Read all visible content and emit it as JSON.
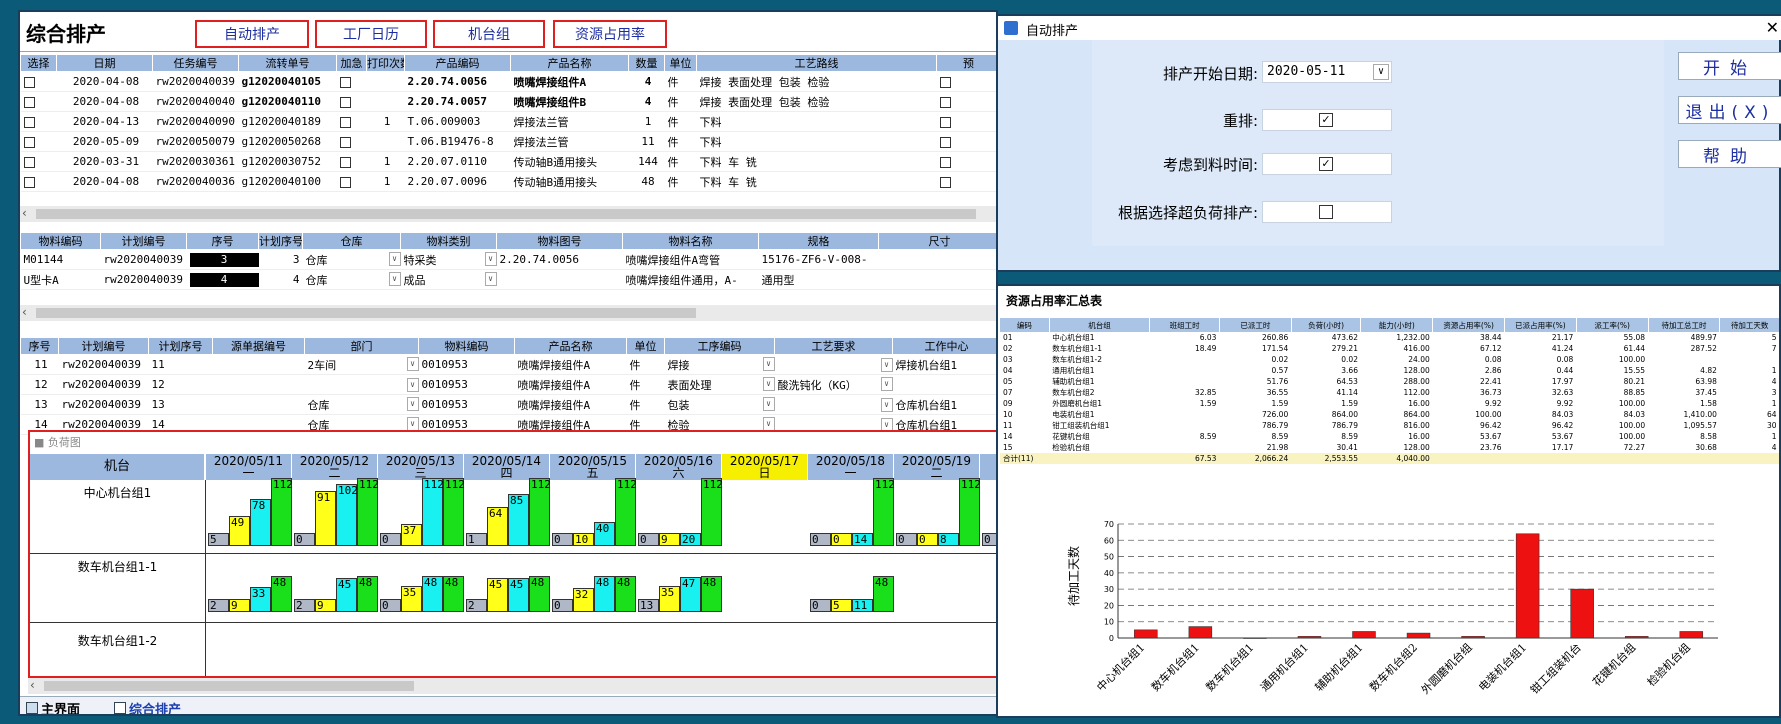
{
  "main": {
    "title": "综合排产",
    "top_buttons": [
      "自动排产",
      "工厂日历",
      "机台组",
      "资源占用率"
    ]
  },
  "order_table": {
    "headers": [
      "选择",
      "日期",
      "任务编号",
      "流转单号",
      "加急",
      "打印次数",
      "产品编码",
      "产品名称",
      "数量",
      "单位",
      "工艺路线",
      "预"
    ],
    "rows": [
      {
        "date": "2020-04-08",
        "task": "rw2020040039",
        "flow": "g12020040105",
        "print": "",
        "code": "2.20.74.0056",
        "name": "喷嘴焊接组件A",
        "qty": "4",
        "unit": "件",
        "route": "焊接 表面处理 包装 检验",
        "bold": true
      },
      {
        "date": "2020-04-08",
        "task": "rw2020040040",
        "flow": "g12020040110",
        "print": "",
        "code": "2.20.74.0057",
        "name": "喷嘴焊接组件B",
        "qty": "4",
        "unit": "件",
        "route": "焊接 表面处理 包装 检验",
        "bold": true
      },
      {
        "date": "2020-04-13",
        "task": "rw2020040090",
        "flow": "g12020040189",
        "print": "1",
        "code": "T.06.009003",
        "name": "焊接法兰管",
        "qty": "1",
        "unit": "件",
        "route": "下料",
        "bold": false
      },
      {
        "date": "2020-05-09",
        "task": "rw2020050079",
        "flow": "g12020050268",
        "print": "",
        "code": "T.06.B19476-8",
        "name": "焊接法兰管",
        "qty": "11",
        "unit": "件",
        "route": "下料",
        "bold": false
      },
      {
        "date": "2020-03-31",
        "task": "rw2020030361",
        "flow": "g12020030752",
        "print": "1",
        "code": "2.20.07.0110",
        "name": "传动轴B通用接头",
        "qty": "144",
        "unit": "件",
        "route": "下料 车 铣",
        "bold": false
      },
      {
        "date": "2020-04-08",
        "task": "rw2020040036",
        "flow": "g12020040100",
        "print": "1",
        "code": "2.20.07.0096",
        "name": "传动轴B通用接头",
        "qty": "48",
        "unit": "件",
        "route": "下料 车 铣",
        "bold": false
      }
    ]
  },
  "material_table": {
    "headers": [
      "物料编码",
      "计划编号",
      "序号",
      "计划序号",
      "仓库",
      "物料类别",
      "物料图号",
      "物料名称",
      "规格",
      "尺寸"
    ],
    "rows": [
      {
        "code": "M01144",
        "plan": "rw2020040039",
        "seq": "3",
        "planseq": "3",
        "wh": "仓库",
        "cat": "特采类",
        "drawing": "2.20.74.0056",
        "name": "喷嘴焊接组件A弯管",
        "spec": "15176-ZF6-V-008-",
        "size": ""
      },
      {
        "code": "U型卡A",
        "plan": "rw2020040039",
        "seq": "4",
        "planseq": "4",
        "wh": "仓库",
        "cat": "成品",
        "drawing": "",
        "name": "喷嘴焊接组件通用，A-",
        "spec": "通用型",
        "size": ""
      }
    ]
  },
  "process_table": {
    "headers": [
      "序号",
      "计划编号",
      "计划序号",
      "源单据编号",
      "部门",
      "物料编码",
      "产品名称",
      "单位",
      "工序编码",
      "工艺要求",
      "工作中心"
    ],
    "rows": [
      {
        "seq": "11",
        "plan": "rw2020040039",
        "planseq": "11",
        "src": "",
        "dept": "2车间",
        "mat": "0010953",
        "name": "喷嘴焊接组件A",
        "unit": "件",
        "proc": "焊接",
        "req": "",
        "center": "焊接机台组1"
      },
      {
        "seq": "12",
        "plan": "rw2020040039",
        "planseq": "12",
        "src": "",
        "dept": "",
        "mat": "0010953",
        "name": "喷嘴焊接组件A",
        "unit": "件",
        "proc": "表面处理",
        "req": "酸洗钝化（KG）",
        "center": ""
      },
      {
        "seq": "13",
        "plan": "rw2020040039",
        "planseq": "13",
        "src": "",
        "dept": "仓库",
        "mat": "0010953",
        "name": "喷嘴焊接组件A",
        "unit": "件",
        "proc": "包装",
        "req": "",
        "center": "仓库机台组1"
      },
      {
        "seq": "14",
        "plan": "rw2020040039",
        "planseq": "14",
        "src": "",
        "dept": "仓库",
        "mat": "0010953",
        "name": "喷嘴焊接组件A",
        "unit": "件",
        "proc": "检验",
        "req": "",
        "center": "仓库机台组1"
      }
    ]
  },
  "load_chart": {
    "title": "负荷图",
    "machine_header": "机台",
    "dates": [
      {
        "date": "2020/05/11",
        "dow": "一",
        "sun": false
      },
      {
        "date": "2020/05/12",
        "dow": "二",
        "sun": false
      },
      {
        "date": "2020/05/13",
        "dow": "三",
        "sun": false
      },
      {
        "date": "2020/05/14",
        "dow": "四",
        "sun": false
      },
      {
        "date": "2020/05/15",
        "dow": "五",
        "sun": false
      },
      {
        "date": "2020/05/16",
        "dow": "六",
        "sun": false
      },
      {
        "date": "2020/05/17",
        "dow": "日",
        "sun": true
      },
      {
        "date": "2020/05/18",
        "dow": "一",
        "sun": false
      },
      {
        "date": "2020/05/19",
        "dow": "二",
        "sun": false
      },
      {
        "date": "20",
        "dow": "",
        "sun": false
      }
    ],
    "machines": [
      "中心机台组1",
      "数车机台组1-1",
      "数车机台组1-2"
    ],
    "groups1": [
      [
        5,
        49,
        78,
        112
      ],
      [
        0,
        91,
        102,
        112
      ],
      [
        0,
        37,
        112,
        112
      ],
      [
        1,
        64,
        85,
        112
      ],
      [
        0,
        10,
        40,
        112
      ],
      [
        0,
        9,
        20,
        112
      ],
      null,
      [
        0,
        0,
        14,
        112
      ],
      [
        0,
        0,
        8,
        112
      ],
      [
        0
      ]
    ],
    "groups2": [
      [
        2,
        9,
        33,
        48
      ],
      [
        2,
        9,
        45,
        48
      ],
      [
        0,
        35,
        48,
        48
      ],
      [
        2,
        45,
        45,
        48
      ],
      [
        0,
        32,
        48,
        48
      ],
      [
        13,
        35,
        47,
        48
      ],
      null,
      [
        0,
        5,
        11,
        48
      ],
      null,
      null
    ]
  },
  "tabs": [
    "主界面",
    "综合排产"
  ],
  "dialog": {
    "title": "自动排产",
    "start_label": "排产开始日期:",
    "start_value": "2020-05-11",
    "reschedule_label": "重排:",
    "arrival_label": "考虑到料时间:",
    "overload_label": "根据选择超负荷排产:",
    "btn_start": "开始",
    "btn_exit": "退出(X)",
    "btn_help": "帮助"
  },
  "resource": {
    "title": "资源占用率汇总表",
    "headers": [
      "编码",
      "机台组",
      "班组工时",
      "已派工时",
      "负荷(小时)",
      "能力(小时)",
      "资源占用率(%)",
      "已派占用率(%)",
      "派工率(%)",
      "待加工总工时",
      "待加工天数"
    ],
    "rows": [
      [
        "01",
        "中心机台组1",
        "6.03",
        "260.86",
        "473.62",
        "1,232.00",
        "38.44",
        "21.17",
        "55.08",
        "489.97",
        "5"
      ],
      [
        "02",
        "数车机台组1-1",
        "18.49",
        "171.54",
        "279.21",
        "416.00",
        "67.12",
        "41.24",
        "61.44",
        "287.52",
        "7"
      ],
      [
        "03",
        "数车机台组1-2",
        "",
        "0.02",
        "0.02",
        "24.00",
        "0.08",
        "0.08",
        "100.00",
        "",
        ""
      ],
      [
        "04",
        "通用机台组1",
        "",
        "0.57",
        "3.66",
        "128.00",
        "2.86",
        "0.44",
        "15.55",
        "4.82",
        "1"
      ],
      [
        "05",
        "辅助机台组1",
        "",
        "51.76",
        "64.53",
        "288.00",
        "22.41",
        "17.97",
        "80.21",
        "63.98",
        "4"
      ],
      [
        "07",
        "数车机台组2",
        "32.85",
        "36.55",
        "41.14",
        "112.00",
        "36.73",
        "32.63",
        "88.85",
        "37.45",
        "3"
      ],
      [
        "09",
        "外圆磨机台组1",
        "1.59",
        "1.59",
        "1.59",
        "16.00",
        "9.92",
        "9.92",
        "100.00",
        "1.58",
        "1"
      ],
      [
        "10",
        "电装机台组1",
        "",
        "726.00",
        "864.00",
        "864.00",
        "100.00",
        "84.03",
        "84.03",
        "1,410.00",
        "64"
      ],
      [
        "11",
        "钳工组装机台组1",
        "",
        "786.79",
        "786.79",
        "816.00",
        "96.42",
        "96.42",
        "100.00",
        "1,095.57",
        "30"
      ],
      [
        "14",
        "花键机台组",
        "8.59",
        "8.59",
        "8.59",
        "16.00",
        "53.67",
        "53.67",
        "100.00",
        "8.58",
        "1"
      ],
      [
        "15",
        "检验机台组",
        "",
        "21.98",
        "30.41",
        "128.00",
        "23.76",
        "17.17",
        "72.27",
        "30.68",
        "4"
      ]
    ],
    "total": [
      "合计(11)",
      "",
      "67.53",
      "2,066.24",
      "2,553.55",
      "4,040.00",
      "",
      "",
      "",
      "",
      ""
    ]
  },
  "chart_data": {
    "type": "bar",
    "ylabel": "待加工天数",
    "categories": [
      "中心机台组1",
      "数车机台组1",
      "数车机台组1",
      "通用机台组1",
      "辅助机台组1",
      "数车机台组2",
      "外圆磨机台组",
      "电装机台组1",
      "钳工组装机台",
      "花键机台组",
      "检验机台组"
    ],
    "values": [
      5,
      7,
      0,
      1,
      4,
      3,
      1,
      64,
      30,
      1,
      4
    ],
    "ylim": [
      0,
      70
    ],
    "yticks": [
      0,
      10,
      20,
      30,
      40,
      50,
      60,
      70
    ],
    "bar_color": "#ee1111"
  }
}
